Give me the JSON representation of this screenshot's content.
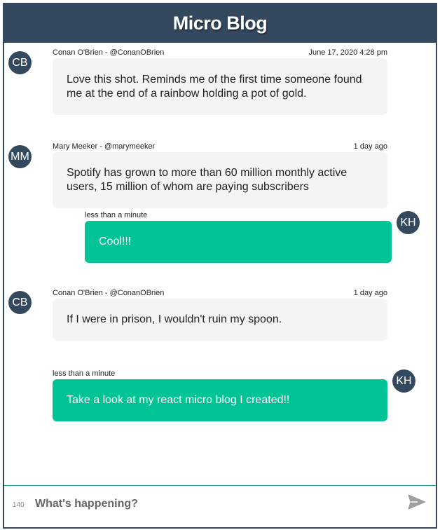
{
  "header": {
    "title": "Micro Blog"
  },
  "messages": [
    {
      "initials": "CB",
      "author": "Conan O'Brien - @ConanOBrien",
      "time": "June 17, 2020 4:28 pm",
      "text": "Love this shot. Reminds me of the first time someone found me at the end of a rainbow holding a pot of gold."
    },
    {
      "initials": "MM",
      "author": "Mary Meeker - @marymeeker",
      "time": "1 day ago",
      "text": "Spotify has grown to more than 60 million monthly active users, 15 million of whom are paying subscribers"
    },
    {
      "initials": "KH",
      "time": "less than a minute",
      "text": "Cool!!!"
    },
    {
      "initials": "CB",
      "author": "Conan O'Brien - @ConanOBrien",
      "time": "1 day ago",
      "text": "If I were in prison, I wouldn't ruin my spoon."
    },
    {
      "initials": "KH",
      "time": "less than a minute",
      "text": "Take a look at my react micro blog I created!!"
    }
  ],
  "composer": {
    "counter": "140",
    "placeholder": "What's happening?",
    "send_icon": "send-icon"
  },
  "colors": {
    "header": "#34495e",
    "avatar": "#34495e",
    "own_bubble": "#00c496",
    "other_bubble": "#f4f4f4"
  }
}
